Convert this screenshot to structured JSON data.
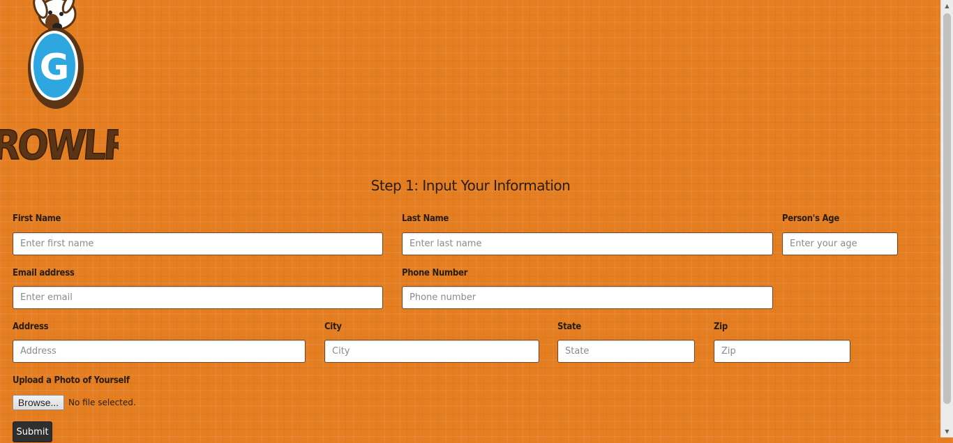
{
  "brand": {
    "logo_text": "GROWLR",
    "logo_letter": "G"
  },
  "form": {
    "title": "Step 1: Input Your Information",
    "first_name": {
      "label": "First Name",
      "placeholder": "Enter first name"
    },
    "last_name": {
      "label": "Last Name",
      "placeholder": "Enter last name"
    },
    "age": {
      "label": "Person's Age",
      "placeholder": "Enter your age"
    },
    "email": {
      "label": "Email address",
      "placeholder": "Enter email"
    },
    "phone": {
      "label": "Phone Number",
      "placeholder": "Phone number"
    },
    "address": {
      "label": "Address",
      "placeholder": "Address"
    },
    "city": {
      "label": "City",
      "placeholder": "City"
    },
    "state": {
      "label": "State",
      "placeholder": "State"
    },
    "zip": {
      "label": "Zip",
      "placeholder": "Zip"
    },
    "photo": {
      "label": "Upload a Photo of Yourself",
      "browse_label": "Browse...",
      "status": "No file selected."
    },
    "submit_label": "Submit"
  },
  "colors": {
    "background": "#e47e20",
    "logo_brown": "#5a3414",
    "logo_blue": "#2ea6e0",
    "text": "#2a1d12"
  },
  "icons": {
    "scroll_up": "scroll-up-arrow-icon",
    "scroll_down": "scroll-down-arrow-icon"
  }
}
